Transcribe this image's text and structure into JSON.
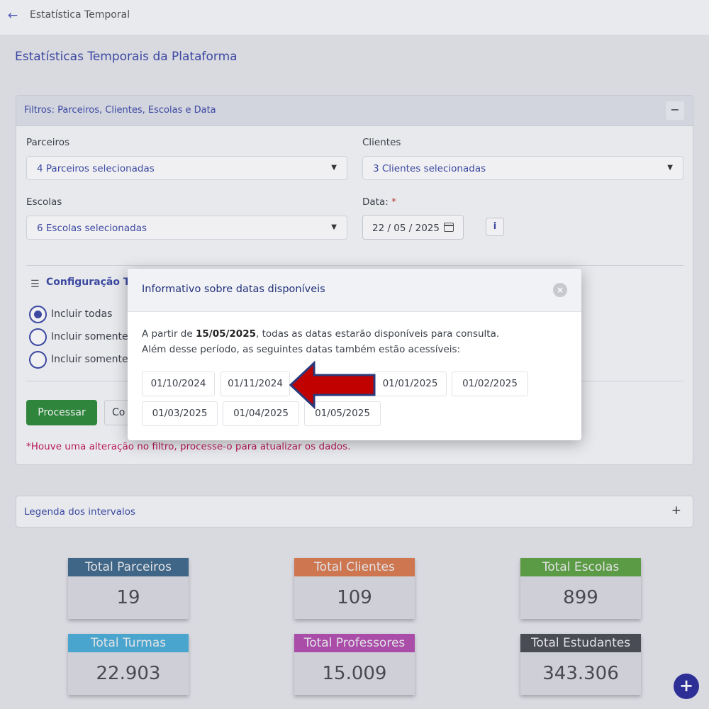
{
  "topbar": {
    "title": "Estatística Temporal",
    "back_icon": "arrow-left-icon"
  },
  "page": {
    "title": "Estatísticas Temporais da Plataforma"
  },
  "filters": {
    "title": "Filtros: Parceiros, Clientes, Escolas e Data",
    "collapse_label": "−",
    "parceiros": {
      "label": "Parceiros",
      "value": "4 Parceiros selecionadas"
    },
    "clientes": {
      "label": "Clientes",
      "value": "3 Clientes selecionadas"
    },
    "escolas": {
      "label": "Escolas",
      "value": "6 Escolas selecionadas"
    },
    "data": {
      "label": "Data:",
      "required_mark": "*",
      "value": "22 / 05 / 2025"
    },
    "info_label": "i",
    "config": {
      "title": "Configuração Tu",
      "options": [
        "Incluir todas",
        "Incluir somente",
        "Incluir somente"
      ],
      "selected_index": 0
    },
    "process_label": "Processar",
    "second_button_label": "Co",
    "warning": "*Houve uma alteração no filtro, processe-o para atualizar os dados."
  },
  "legend": {
    "title": "Legenda dos intervalos",
    "expand_label": "+"
  },
  "stats": [
    {
      "label": "Total Parceiros",
      "value": "19",
      "color": "#3f6a8a"
    },
    {
      "label": "Total Clientes",
      "value": "109",
      "color": "#d97b4f"
    },
    {
      "label": "Total Escolas",
      "value": "899",
      "color": "#5fa344"
    },
    {
      "label": "Total Turmas",
      "value": "22.903",
      "color": "#4aaed8"
    },
    {
      "label": "Total Professores",
      "value": "15.009",
      "color": "#b44fb0"
    },
    {
      "label": "Total Estudantes",
      "value": "343.306",
      "color": "#4a4c55"
    }
  ],
  "fab_label": "+",
  "modal": {
    "title": "Informativo sobre datas disponíveis",
    "close_label": "×",
    "line1_prefix": "A partir de ",
    "line1_bold": "15/05/2025",
    "line1_suffix": ", todas as datas estarão disponíveis para consulta.",
    "line2": "Além desse período, as seguintes datas também estão acessíveis:",
    "dates": [
      "01/10/2024",
      "01/11/2024",
      "01/01/2025",
      "01/02/2025",
      "01/03/2025",
      "01/04/2025",
      "01/05/2025"
    ]
  },
  "annotation": {
    "arrow_color": "#c10000",
    "arrow_outline": "#2b3a7a"
  }
}
